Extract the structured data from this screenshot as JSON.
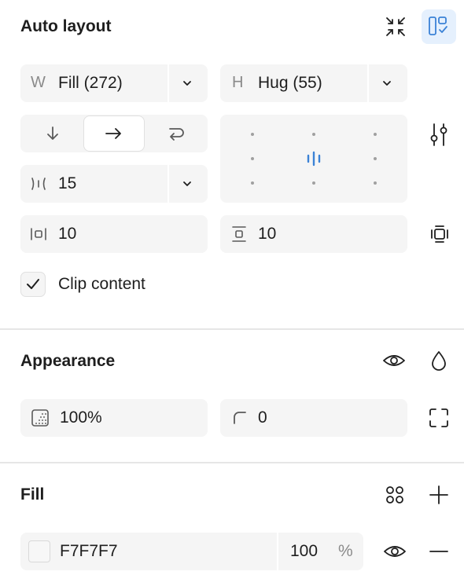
{
  "auto_layout": {
    "title": "Auto layout",
    "width": {
      "prefix": "W",
      "value": "Fill (272)"
    },
    "height": {
      "prefix": "H",
      "value": "Hug (55)"
    },
    "direction_selected": "horizontal",
    "gap": "15",
    "padding_horizontal": "10",
    "padding_vertical": "10",
    "clip_content": {
      "label": "Clip content",
      "checked": true
    },
    "accent_color": "#3b82d6"
  },
  "appearance": {
    "title": "Appearance",
    "opacity": "100%",
    "corner_radius": "0"
  },
  "fill": {
    "title": "Fill",
    "hex": "F7F7F7",
    "opacity": "100",
    "percent_symbol": "%",
    "swatch_color": "#F7F7F7"
  }
}
